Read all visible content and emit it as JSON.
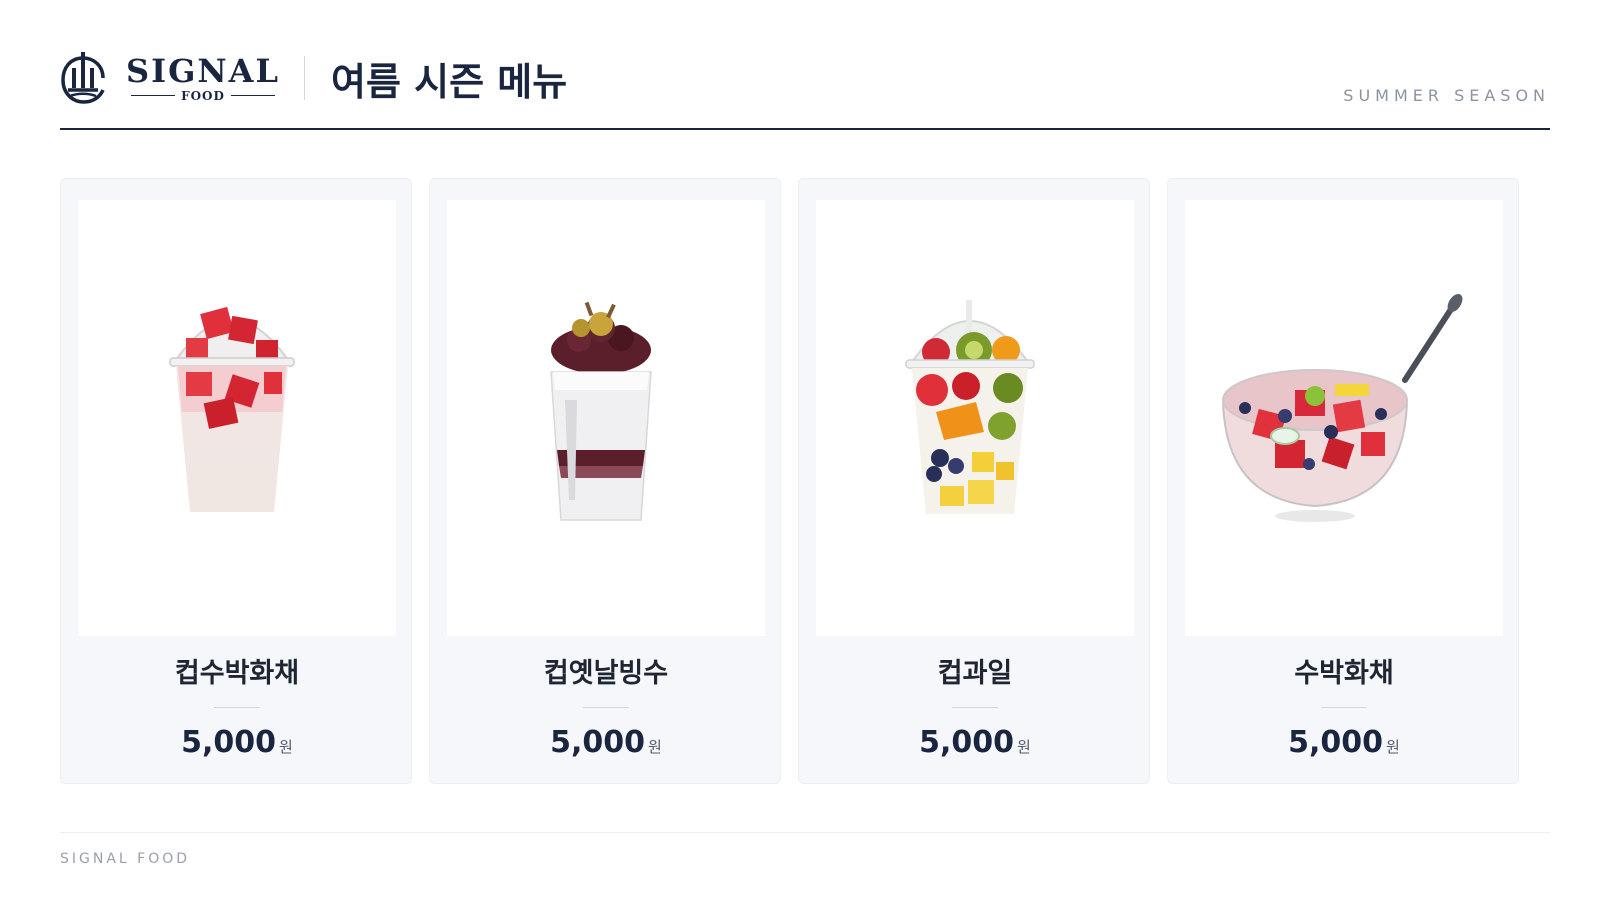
{
  "header": {
    "brand_main": "SIGNAL",
    "brand_sub": "FOOD",
    "title": "여름 시즌 메뉴",
    "season_label": "SUMMER SEASON"
  },
  "menu": [
    {
      "name": "컵수박화채",
      "price": "5,000",
      "unit": "원",
      "image": "watermelon-punch-cup-image"
    },
    {
      "name": "컵옛날빙수",
      "price": "5,000",
      "unit": "원",
      "image": "red-bean-bingsu-cup-image"
    },
    {
      "name": "컵과일",
      "price": "5,000",
      "unit": "원",
      "image": "fruit-cup-image"
    },
    {
      "name": "수박화채",
      "price": "5,000",
      "unit": "원",
      "image": "watermelon-punch-bowl-image"
    }
  ],
  "footer": {
    "text": "SIGNAL FOOD"
  },
  "colors": {
    "navy": "#1a2540",
    "card_bg": "#f6f7fa",
    "muted": "#8c93a1"
  }
}
